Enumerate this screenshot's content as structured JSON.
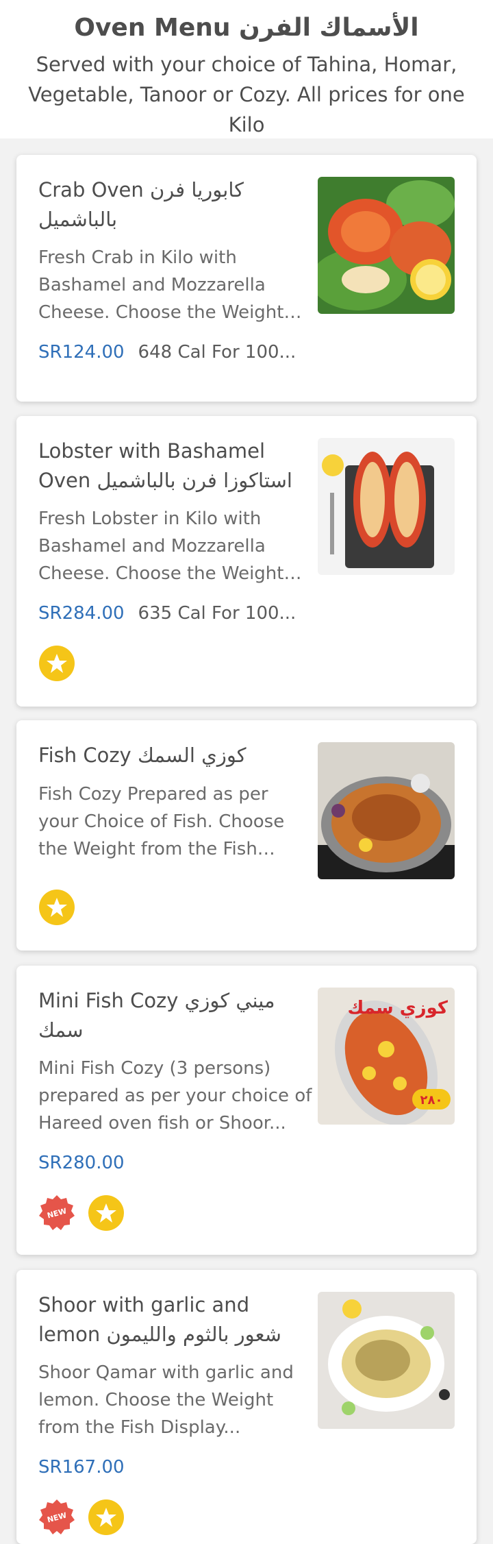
{
  "header": {
    "title": "Oven Menu الأسماك الفرن",
    "subtitle": "Served with your choice of Tahina, Homar, Vegetable, Tanoor or Cozy. All prices for one Kilo"
  },
  "items": [
    {
      "name": "Crab Oven كابوريا فرن بالباشميل",
      "description": "Fresh Crab in Kilo with Bashamel and Mozzarella Cheese. Choose the Weight from the Fish Display",
      "price": "SR124.00",
      "calories": "648 Cal For 100...",
      "badges": []
    },
    {
      "name": "Lobster with Bashamel Oven استاكوزا فرن بالباشميل",
      "description": "Fresh Lobster in Kilo with Bashamel and Mozzarella Cheese. Choose the Weight from the Fish Display",
      "price": "SR284.00",
      "calories": "635 Cal For 100...",
      "badges": [
        "star"
      ]
    },
    {
      "name": "Fish Cozy كوزي السمك",
      "description": "Fish Cozy Prepared as per your Choice of Fish. Choose the Weight from the Fish Display...",
      "price": "",
      "calories": "",
      "badges": [
        "star"
      ]
    },
    {
      "name": "Mini Fish Cozy ميني كوزي سمك",
      "description": "Mini Fish Cozy (3 persons) prepared as per your choice of Hareed oven fish or Shoor...",
      "price": "SR280.00",
      "calories": "",
      "badges": [
        "new",
        "star"
      ],
      "image_text": "كوزي سمك",
      "image_price": "٢٨٠"
    },
    {
      "name": "Shoor with garlic and lemon شعور بالثوم والليمون",
      "description": "Shoor Qamar with garlic and lemon. Choose the Weight from the Fish Display...",
      "price": "SR167.00",
      "calories": "",
      "badges": [
        "new",
        "star"
      ]
    }
  ],
  "badge_labels": {
    "new": "NEW"
  },
  "colors": {
    "price": "#2f6fb8",
    "star_badge": "#f5c518",
    "new_badge": "#e5554a"
  }
}
